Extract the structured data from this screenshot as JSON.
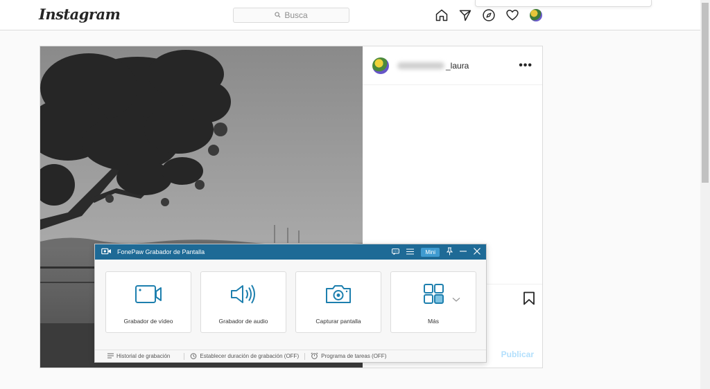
{
  "instagram": {
    "logo": "Instagram",
    "search_placeholder": "Busca",
    "nav_icons": [
      "home-icon",
      "direct-send-icon",
      "explore-compass-icon",
      "activity-heart-icon",
      "profile-avatar"
    ]
  },
  "post": {
    "username_suffix": "_laura",
    "more_label": "•••",
    "publish_label": "Publicar"
  },
  "fonepaw": {
    "title": "FonePaw Grabador de Pantalla",
    "mini_label": "Mini",
    "cards": [
      {
        "label": "Grabador de vídeo",
        "icon": "video-camera-icon"
      },
      {
        "label": "Grabador de audio",
        "icon": "speaker-icon"
      },
      {
        "label": "Capturar pantalla",
        "icon": "camera-icon"
      },
      {
        "label": "Más",
        "icon": "grid-icon"
      }
    ],
    "footer": {
      "history": "Historial de grabación",
      "duration": "Establecer duración de grabación (OFF)",
      "schedule": "Programa de tareas (OFF)"
    }
  },
  "colors": {
    "fonepaw_accent": "#1e6a96",
    "fonepaw_icon": "#1d7fae",
    "ig_border": "#dbdbdb",
    "publish_disabled": "#b2dffc"
  }
}
